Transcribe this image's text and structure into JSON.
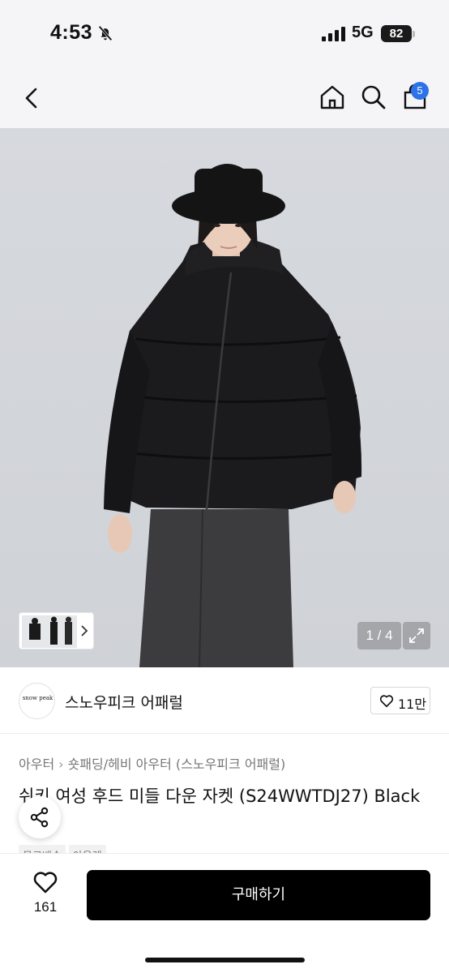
{
  "status_bar": {
    "time": "4:53",
    "network": "5G",
    "battery": "82"
  },
  "nav": {
    "cart_badge": "5"
  },
  "gallery": {
    "counter": "1 / 4"
  },
  "brand": {
    "logo_text": "snow peak",
    "name": "스노우피크 어패럴",
    "like_count": "11만"
  },
  "product": {
    "breadcrumb": [
      "아우터",
      "숏패딩/헤비 아우터 (스노우피크 어패럴)"
    ],
    "title": "쉬키 여성 후드 미들 다운 자켓 (S24WWTDJ27) Black",
    "tags": [
      "무료배송",
      "아울렛"
    ]
  },
  "bottom": {
    "wish_count": "161",
    "buy_label": "구매하기"
  },
  "colors": {
    "badge": "#2c72e8",
    "buy_button": "#000000",
    "hero_bg": "#d4d7dc"
  },
  "icons": [
    "bell-off-icon",
    "signal-icon",
    "back-icon",
    "home-icon",
    "search-icon",
    "cart-icon",
    "chevron-right-icon",
    "expand-icon",
    "heart-icon",
    "share-icon"
  ]
}
